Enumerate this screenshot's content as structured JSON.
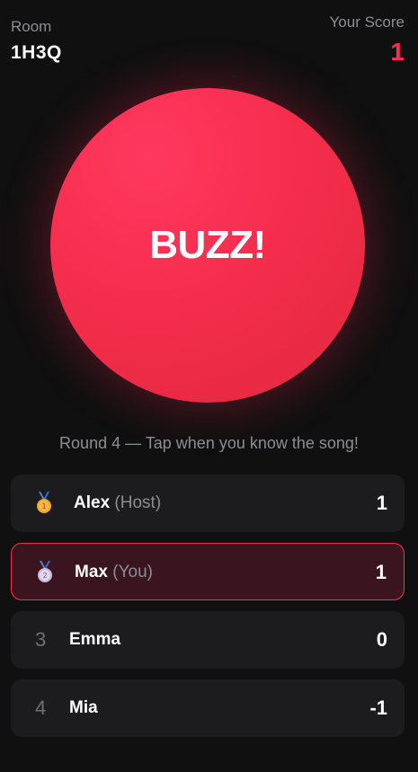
{
  "header": {
    "room_label": "Room",
    "room_code": "1H3Q",
    "score_label": "Your Score",
    "score_value": "1"
  },
  "buzzer": {
    "label": "BUZZ!"
  },
  "instruction": "Round 4 — Tap when you know the song!",
  "colors": {
    "background": "#101010",
    "accent": "#ff2d55",
    "row_background": "#1c1c1e",
    "self_row_background": "#3a1520",
    "gold_medal": "#f5a623",
    "silver_medal": "#d9cdea",
    "ribbon": "#4a8fe0"
  },
  "leaderboard": [
    {
      "rank": "1",
      "rank_icon": "gold-medal-icon",
      "name": "Alex",
      "tag": "(Host)",
      "score": "1",
      "is_self": false
    },
    {
      "rank": "2",
      "rank_icon": "silver-medal-icon",
      "name": "Max",
      "tag": "(You)",
      "score": "1",
      "is_self": true
    },
    {
      "rank": "3",
      "name": "Emma",
      "tag": "",
      "score": "0",
      "is_self": false
    },
    {
      "rank": "4",
      "name": "Mia",
      "tag": "",
      "score": "-1",
      "is_self": false
    }
  ]
}
